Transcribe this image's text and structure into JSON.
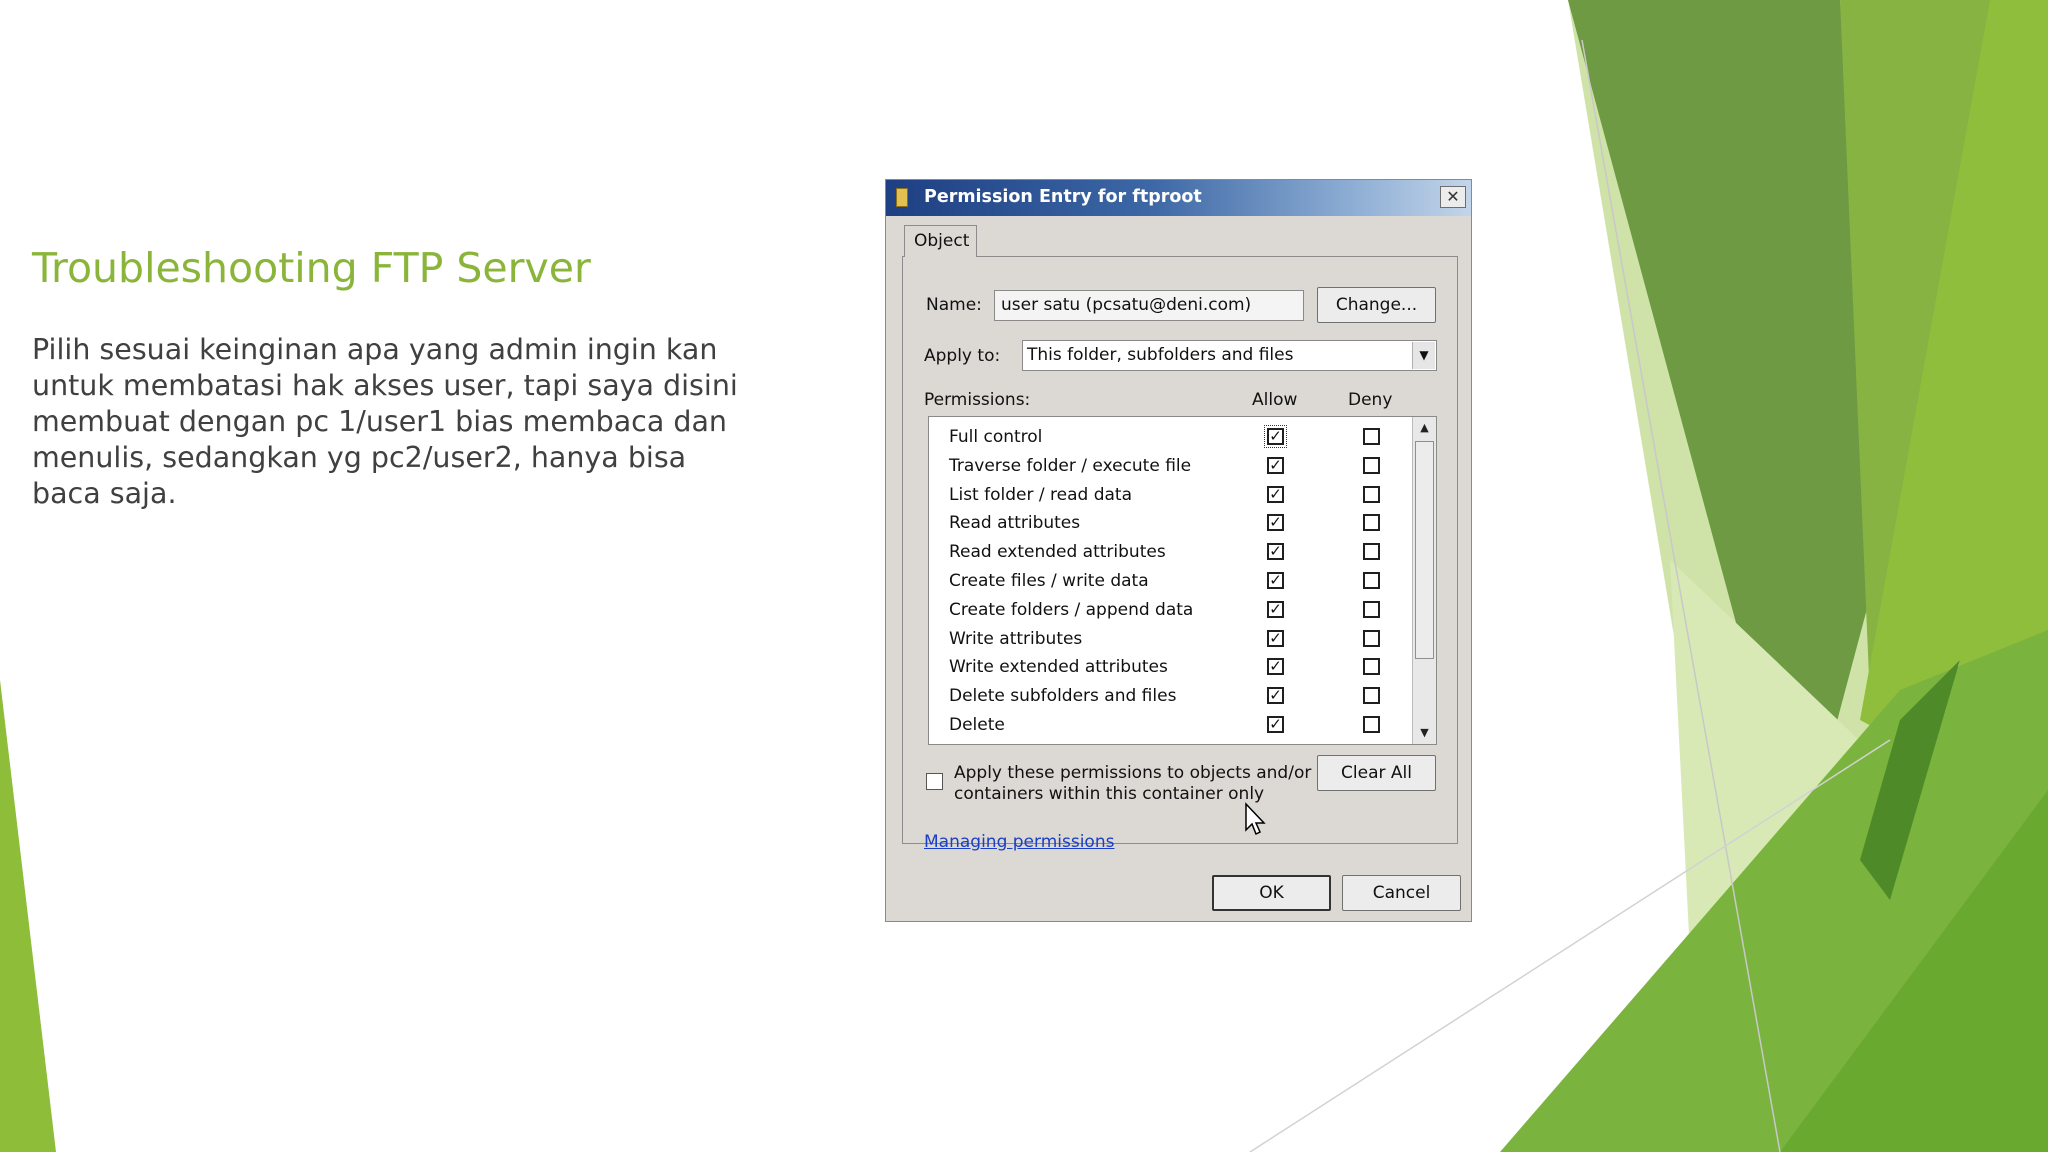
{
  "slide": {
    "title": "Troubleshooting FTP Server",
    "body": "Pilih sesuai keinginan apa yang admin ingin kan untuk membatasi hak akses user, tapi saya disini membuat dengan pc 1/user1 bias membaca dan menulis, sedangkan yg pc2/user2, hanya bisa baca saja."
  },
  "dialog": {
    "title": "Permission Entry for ftproot",
    "close_glyph": "✕",
    "tab": "Object",
    "name_label": "Name:",
    "name_value": "user satu (pcsatu@deni.com)",
    "change_button": "Change...",
    "apply_to_label": "Apply to:",
    "apply_to_value": "This folder, subfolders and files",
    "permissions_label": "Permissions:",
    "allow_header": "Allow",
    "deny_header": "Deny",
    "permissions": [
      {
        "name": "Full control",
        "allow": true,
        "deny": false
      },
      {
        "name": "Traverse folder / execute file",
        "allow": true,
        "deny": false
      },
      {
        "name": "List folder / read data",
        "allow": true,
        "deny": false
      },
      {
        "name": "Read attributes",
        "allow": true,
        "deny": false
      },
      {
        "name": "Read extended attributes",
        "allow": true,
        "deny": false
      },
      {
        "name": "Create files / write data",
        "allow": true,
        "deny": false
      },
      {
        "name": "Create folders / append data",
        "allow": true,
        "deny": false
      },
      {
        "name": "Write attributes",
        "allow": true,
        "deny": false
      },
      {
        "name": "Write extended attributes",
        "allow": true,
        "deny": false
      },
      {
        "name": "Delete subfolders and files",
        "allow": true,
        "deny": false
      },
      {
        "name": "Delete",
        "allow": true,
        "deny": false
      }
    ],
    "apply_only_checked": false,
    "apply_only_line1": "Apply these permissions to objects and/or",
    "apply_only_line2": "containers within this container only",
    "clear_all_button": "Clear All",
    "managing_link": "Managing permissions",
    "ok_button": "OK",
    "cancel_button": "Cancel"
  },
  "colors": {
    "title_green": "#8ab53a",
    "body_text": "#404040",
    "titlebar_blue": "#1e3f83",
    "dialog_face": "#dcd9d4",
    "link_blue": "#1a3ec4"
  },
  "icons": {
    "title": "folder-icon",
    "close": "close-icon",
    "check": "checkmark",
    "scroll_up": "arrow-up-icon",
    "scroll_down": "arrow-down-icon",
    "dropdown": "chevron-down-icon",
    "pointer": "mouse-cursor"
  }
}
